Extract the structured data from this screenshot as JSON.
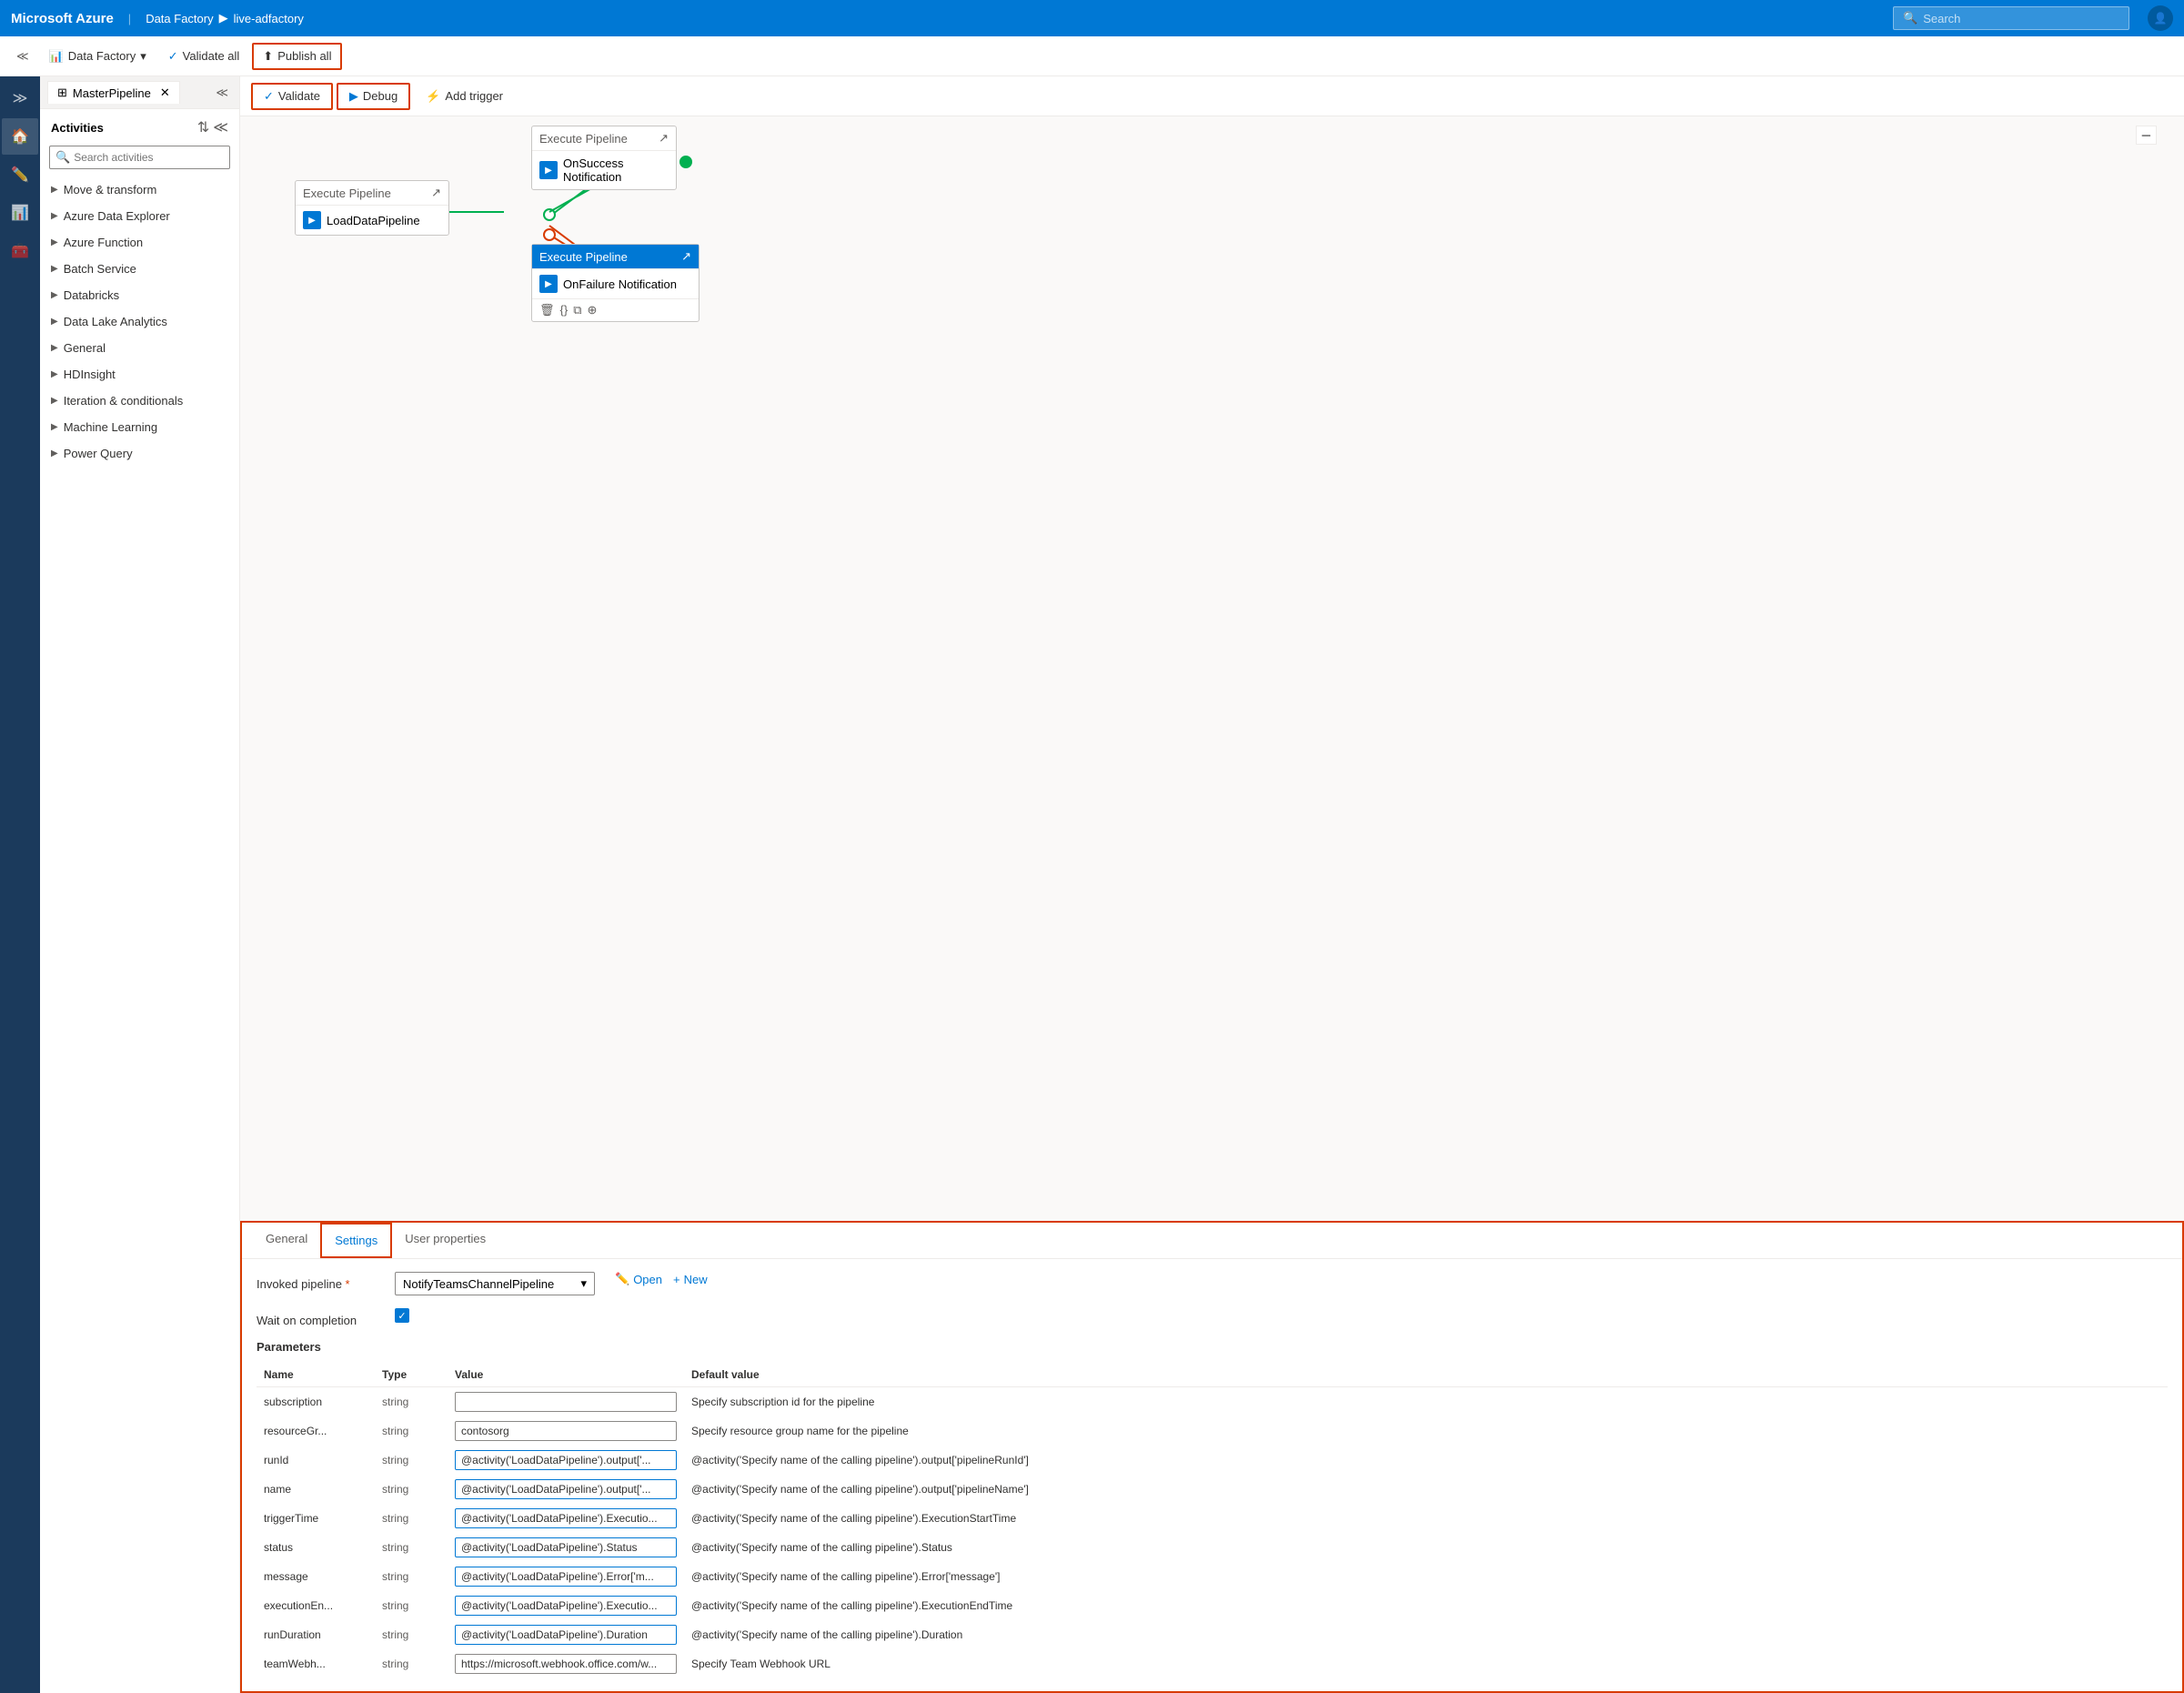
{
  "topbar": {
    "brand": "Microsoft Azure",
    "breadcrumb": [
      "Data Factory",
      "live-adfactory"
    ],
    "search_placeholder": "Search"
  },
  "toolbar2": {
    "data_factory_label": "Data Factory",
    "validate_all_label": "Validate all",
    "publish_all_label": "Publish all"
  },
  "pipeline_tab": {
    "label": "MasterPipeline"
  },
  "activities": {
    "title": "Activities",
    "search_placeholder": "Search activities",
    "groups": [
      {
        "label": "Move & transform"
      },
      {
        "label": "Azure Data Explorer"
      },
      {
        "label": "Azure Function"
      },
      {
        "label": "Batch Service"
      },
      {
        "label": "Databricks"
      },
      {
        "label": "Data Lake Analytics"
      },
      {
        "label": "General"
      },
      {
        "label": "HDInsight"
      },
      {
        "label": "Iteration & conditionals"
      },
      {
        "label": "Machine Learning"
      },
      {
        "label": "Power Query"
      }
    ]
  },
  "pipeline_toolbar": {
    "validate_label": "Validate",
    "debug_label": "Debug",
    "add_trigger_label": "Add trigger"
  },
  "nodes": {
    "load_data": {
      "header": "Execute Pipeline",
      "body": "LoadDataPipeline"
    },
    "on_success": {
      "header": "Execute Pipeline",
      "body": "OnSuccess\nNotification"
    },
    "on_failure": {
      "header": "Execute Pipeline",
      "body": "OnFailure Notification"
    }
  },
  "panel": {
    "tabs": [
      "General",
      "Settings",
      "User properties"
    ],
    "active_tab": "Settings",
    "invoked_pipeline_label": "Invoked pipeline",
    "invoked_pipeline_value": "NotifyTeamsChannelPipeline",
    "open_label": "Open",
    "new_label": "New",
    "wait_on_completion_label": "Wait on completion",
    "parameters_title": "Parameters",
    "columns": {
      "name": "Name",
      "type": "Type",
      "value": "Value",
      "default_value": "Default value"
    },
    "parameters": [
      {
        "name": "subscription",
        "type": "string",
        "value": "",
        "default_value": "Specify subscription id for the pipeline"
      },
      {
        "name": "resourceGr...",
        "type": "string",
        "value": "contosorg",
        "default_value": "Specify resource group name for the pipeline"
      },
      {
        "name": "runId",
        "type": "string",
        "value": "@activity('LoadDataPipeline').output['...",
        "default_value": "@activity('Specify name of the calling pipeline').output['pipelineRunId']"
      },
      {
        "name": "name",
        "type": "string",
        "value": "@activity('LoadDataPipeline').output['...",
        "default_value": "@activity('Specify name of the calling pipeline').output['pipelineName']"
      },
      {
        "name": "triggerTime",
        "type": "string",
        "value": "@activity('LoadDataPipeline').Executio...",
        "default_value": "@activity('Specify name of the calling pipeline').ExecutionStartTime"
      },
      {
        "name": "status",
        "type": "string",
        "value": "@activity('LoadDataPipeline').Status",
        "default_value": "@activity('Specify name of the calling pipeline').Status"
      },
      {
        "name": "message",
        "type": "string",
        "value": "@activity('LoadDataPipeline').Error['m...",
        "default_value": "@activity('Specify name of the calling pipeline').Error['message']"
      },
      {
        "name": "executionEn...",
        "type": "string",
        "value": "@activity('LoadDataPipeline').Executio...",
        "default_value": "@activity('Specify name of the calling pipeline').ExecutionEndTime"
      },
      {
        "name": "runDuration",
        "type": "string",
        "value": "@activity('LoadDataPipeline').Duration",
        "default_value": "@activity('Specify name of the calling pipeline').Duration"
      },
      {
        "name": "teamWebh...",
        "type": "string",
        "value": "https://microsoft.webhook.office.com/w...",
        "default_value": "Specify Team Webhook URL"
      }
    ]
  }
}
